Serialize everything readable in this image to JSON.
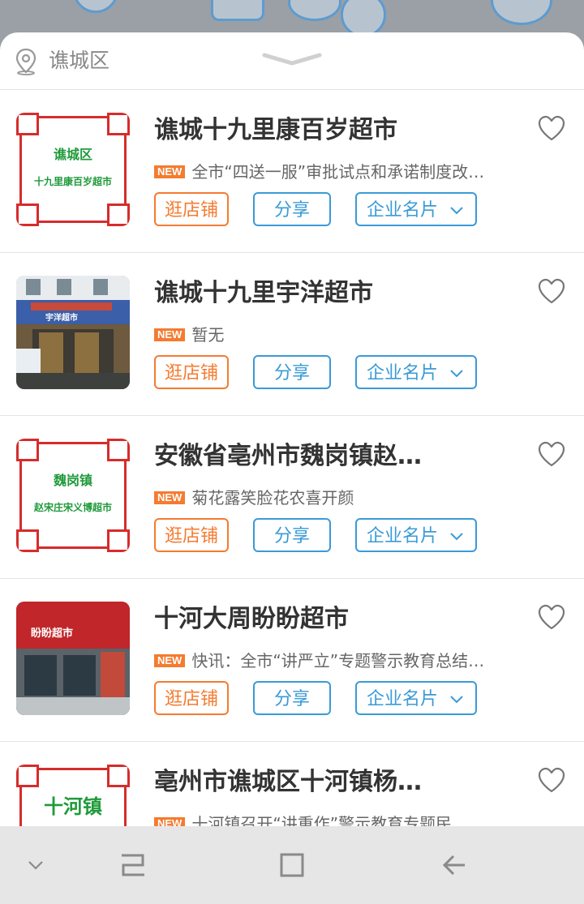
{
  "location": {
    "district": "谯城区"
  },
  "stores": [
    {
      "name": "谯城十九里康百岁超市",
      "news": "全市“四送一服”审批试点和承诺制度改…",
      "thumb": {
        "type": "frame",
        "line1": "谯城区",
        "line2": "十九里康百岁超市"
      }
    },
    {
      "name": "谯城十九里宇洋超市",
      "news": "暂无",
      "thumb": {
        "type": "photo",
        "sign": "宇洋超市"
      }
    },
    {
      "name": "安徽省亳州市魏岗镇赵…",
      "news": "菊花露笑脸花农喜开颜",
      "thumb": {
        "type": "frame",
        "line1": "魏岗镇",
        "line2": "赵宋庄宋义博超市"
      }
    },
    {
      "name": "十河大周盼盼超市",
      "news": "快讯：全市“讲严立”专题警示教育总结…",
      "thumb": {
        "type": "photo",
        "sign": "盼盼超市"
      }
    },
    {
      "name": "亳州市谯城区十河镇杨…",
      "news": "十河镇召开“讲重作”警示教育专题民…",
      "thumb": {
        "type": "frame",
        "line1": "十河镇",
        "line2": ""
      }
    }
  ],
  "labels": {
    "new_badge": "NEW",
    "shop": "逛店铺",
    "share": "分享",
    "card": "企业名片"
  },
  "icons": {
    "location": "location-pin-icon",
    "heart": "heart-outline-icon",
    "handle": "chevron-down-icon"
  },
  "colors": {
    "orange": "#f47b30",
    "blue": "#3a9bd6",
    "frame_red": "#d62c2c",
    "frame_green": "#1f9a3a"
  }
}
